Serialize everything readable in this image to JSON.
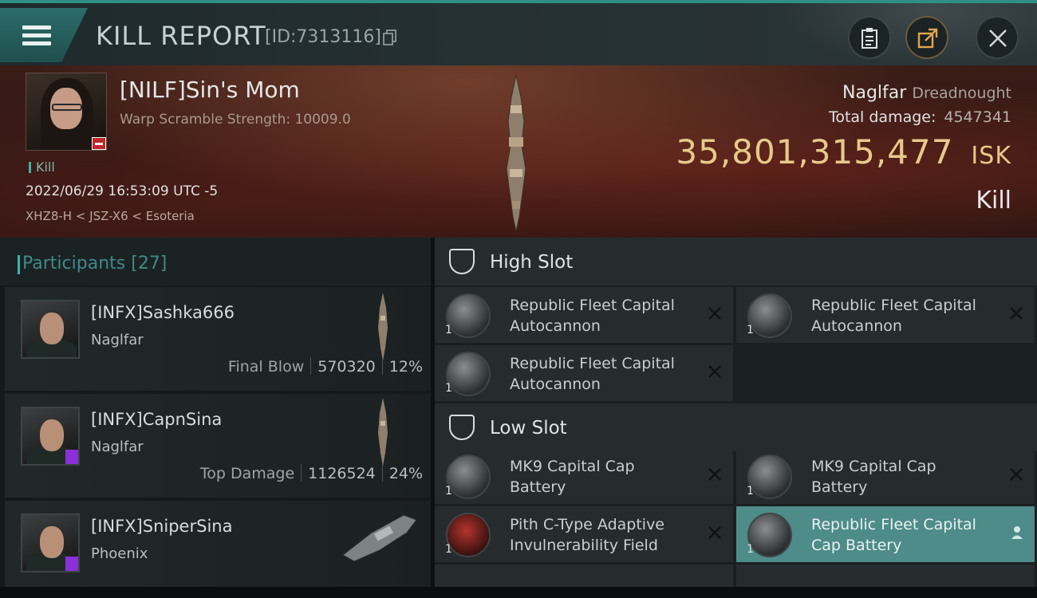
{
  "header": {
    "title": "KILL REPORT",
    "id_text": "[ID:7313116]"
  },
  "victim": {
    "name": "[NILF]Sin's Mom",
    "warp_scramble": "Warp Scramble Strength: 10009.0",
    "tag": "Kill",
    "timestamp": "2022/06/29 16:53:09 UTC -5",
    "location": "XHZ8-H < JSZ-X6 < Esoteria",
    "ship": "Naglfar",
    "ship_class": "Dreadnought",
    "total_damage_label": "Total damage:",
    "total_damage": "4547341",
    "isk_value": "35,801,315,477",
    "isk_unit": "ISK",
    "result": "Kill"
  },
  "participants": {
    "label": "Participants",
    "count": "[27]",
    "rows": [
      {
        "name": "[INFX]Sashka666",
        "ship": "Naglfar",
        "stat_label": "Final Blow",
        "damage": "570320",
        "percent": "12%"
      },
      {
        "name": "[INFX]CapnSina",
        "ship": "Naglfar",
        "stat_label": "Top Damage",
        "damage": "1126524",
        "percent": "24%"
      },
      {
        "name": "[INFX]SniperSina",
        "ship": "Phoenix"
      }
    ]
  },
  "slots": {
    "high": {
      "label": "High Slot",
      "modules": [
        {
          "name_line1": "Republic Fleet Capital",
          "name_line2": "Autocannon",
          "qty": "1"
        },
        {
          "name_line1": "Republic Fleet Capital",
          "name_line2": "Autocannon",
          "qty": "1"
        },
        {
          "name_line1": "Republic Fleet Capital",
          "name_line2": "Autocannon",
          "qty": "1"
        }
      ]
    },
    "low": {
      "label": "Low Slot",
      "modules": [
        {
          "name_line1": "MK9 Capital Cap",
          "name_line2": "Battery",
          "qty": "1"
        },
        {
          "name_line1": "MK9 Capital Cap",
          "name_line2": "Battery",
          "qty": "1"
        },
        {
          "name_line1": "Pith C-Type Adaptive",
          "name_line2": "Invulnerability Field",
          "qty": "1"
        },
        {
          "name_line1": "Republic Fleet Capital",
          "name_line2": "Cap Battery",
          "qty": "1"
        }
      ]
    }
  },
  "icons": {
    "menu": "hamburger-icon",
    "copy": "copy-icon",
    "clipboard": "clipboard-icon",
    "share": "share-icon",
    "close": "close-icon",
    "remove": "x-icon",
    "person": "person-icon"
  },
  "colors": {
    "accent": "#2f8f86",
    "isk": "#e7c98a",
    "selected_row": "#4d8c88",
    "standing_bad": "#c0262b"
  }
}
